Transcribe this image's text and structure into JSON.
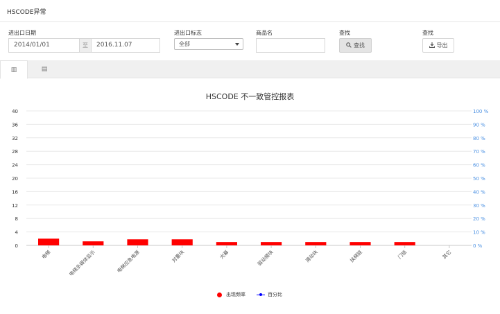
{
  "header": {
    "title": "HSCODE异常"
  },
  "filters": {
    "date_label": "进出口日期",
    "date_from": "2014/01/01",
    "date_sep": "至",
    "date_to": "2016.11.07",
    "ie_flag_label": "进出口标志",
    "ie_flag_value": "全部",
    "goods_name_label": "商品名",
    "goods_name_value": "",
    "query_label": "查找",
    "query_button": "查找",
    "export_label": "查找",
    "export_button": "导出"
  },
  "tabs": [
    {
      "icon": "bar-chart-icon",
      "glyph": "▥",
      "active": true
    },
    {
      "icon": "table-icon",
      "glyph": "▤",
      "active": false
    }
  ],
  "chart_title": "HSCODE 不一致管控报表",
  "chart_data": {
    "type": "bar",
    "title": "HSCODE 不一致管控报表",
    "categories": [
      "电梯",
      "电梯多媒体显示",
      "电梯应急电源",
      "对重块",
      "光幕",
      "驱动模块",
      "滑动块",
      "扶梯链",
      "门锁",
      "其它"
    ],
    "series": [
      {
        "name": "出现频率",
        "values": [
          2,
          1.2,
          1.8,
          1.8,
          1,
          1,
          1,
          1,
          1,
          0
        ],
        "color": "#ff0000"
      },
      {
        "name": "百分比",
        "values": [],
        "color": "#0000ff"
      }
    ],
    "y_ticks": [
      "0",
      "4",
      "8",
      "12",
      "16",
      "20",
      "24",
      "28",
      "32",
      "36",
      "40"
    ],
    "y2_ticks": [
      "0 %",
      "10 %",
      "20 %",
      "30 %",
      "40 %",
      "50 %",
      "60 %",
      "70 %",
      "80 %",
      "90 %",
      "100 %"
    ],
    "ylim": [
      0,
      40
    ],
    "y2lim": [
      0,
      100
    ],
    "grid": true,
    "legend_position": "bottom-center"
  },
  "legend": [
    {
      "label": "出现频率",
      "color": "#ff0000"
    },
    {
      "label": "百分比",
      "color": "#0000ff"
    }
  ]
}
